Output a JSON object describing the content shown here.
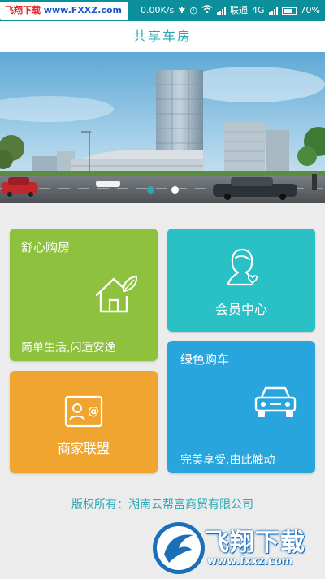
{
  "status_bar": {
    "watermark": {
      "part1": "飞翔下载",
      "part2": "www.FXXZ.com"
    },
    "net_speed": "0.00K/s",
    "carrier": "联通",
    "network": "4G",
    "battery": "70%"
  },
  "header": {
    "title": "共享车房"
  },
  "banner": {
    "slide_count": 2,
    "active_slide": 1
  },
  "tiles": {
    "house": {
      "title": "舒心购房",
      "subtitle": "简单生活,闲适安逸",
      "icon": "house-leaf-icon"
    },
    "member": {
      "title": "会员中心",
      "icon": "female-user-heart-icon"
    },
    "car": {
      "title": "绿色购车",
      "subtitle": "完美享受,由此触动",
      "icon": "car-icon"
    },
    "merchant": {
      "title": "商家联盟",
      "icon": "merchant-card-icon"
    }
  },
  "footer": {
    "copyright": "版权所有：湖南云帮富商贸有限公司"
  },
  "watermark_bottom": {
    "name": "飞翔下载",
    "url": "www.fxxz.com"
  },
  "colors": {
    "status_bar": "#0b8f9a",
    "title": "#29a7b0",
    "house_tile": "#8ec23e",
    "member_tile": "#29c0c6",
    "car_tile": "#29a5dd",
    "merchant_tile": "#f0a531"
  }
}
